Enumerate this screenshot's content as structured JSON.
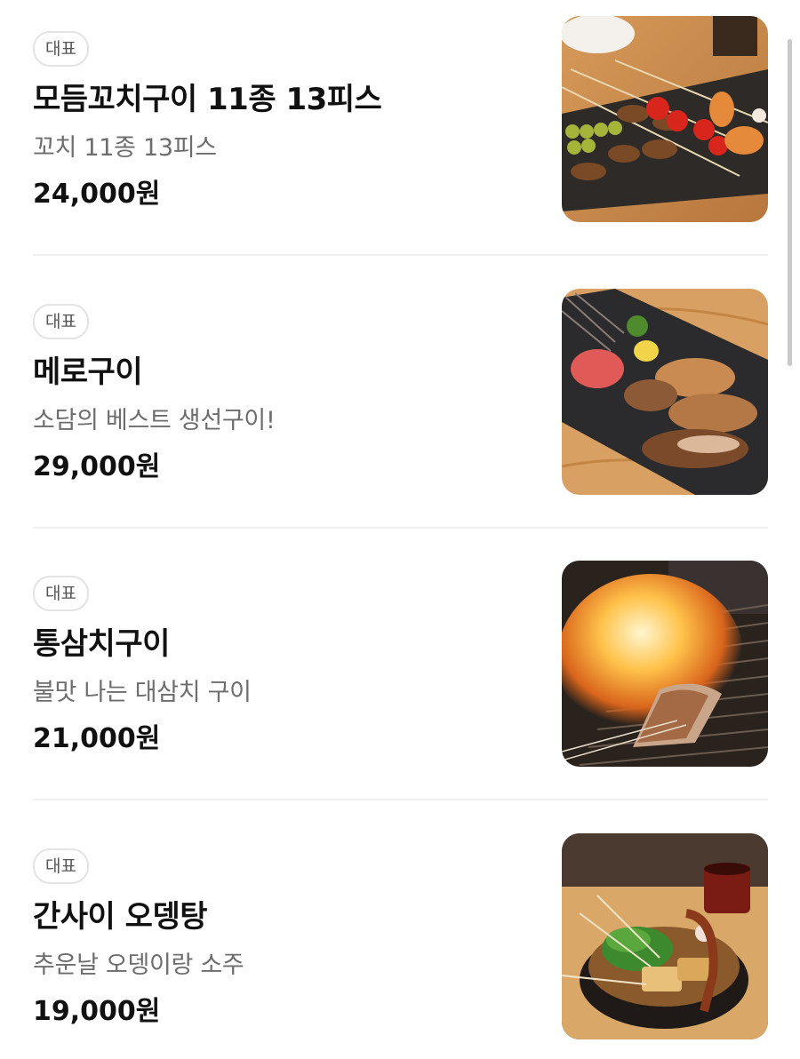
{
  "menu": {
    "items": [
      {
        "badge": "대표",
        "name": "모듬꼬치구이 11종 13피스",
        "description": "꼬치 11종 13피스",
        "price": "24,000원"
      },
      {
        "badge": "대표",
        "name": "메로구이",
        "description": "소담의 베스트 생선구이!",
        "price": "29,000원"
      },
      {
        "badge": "대표",
        "name": "통삼치구이",
        "description": "불맛 나는 대삼치 구이",
        "price": "21,000원"
      },
      {
        "badge": "대표",
        "name": "간사이 오뎅탕",
        "description": "추운날 오뎅이랑 소주",
        "price": "19,000원"
      }
    ]
  },
  "images": [
    {
      "subject": "skewers-photo"
    },
    {
      "subject": "grilled-fish-photo"
    },
    {
      "subject": "flame-grill-photo"
    },
    {
      "subject": "oden-stew-photo"
    }
  ],
  "colors": {
    "text": "#111111",
    "description": "#6d6d6d",
    "badge_border": "#e3e3e3",
    "divider": "#f0f0f0"
  }
}
